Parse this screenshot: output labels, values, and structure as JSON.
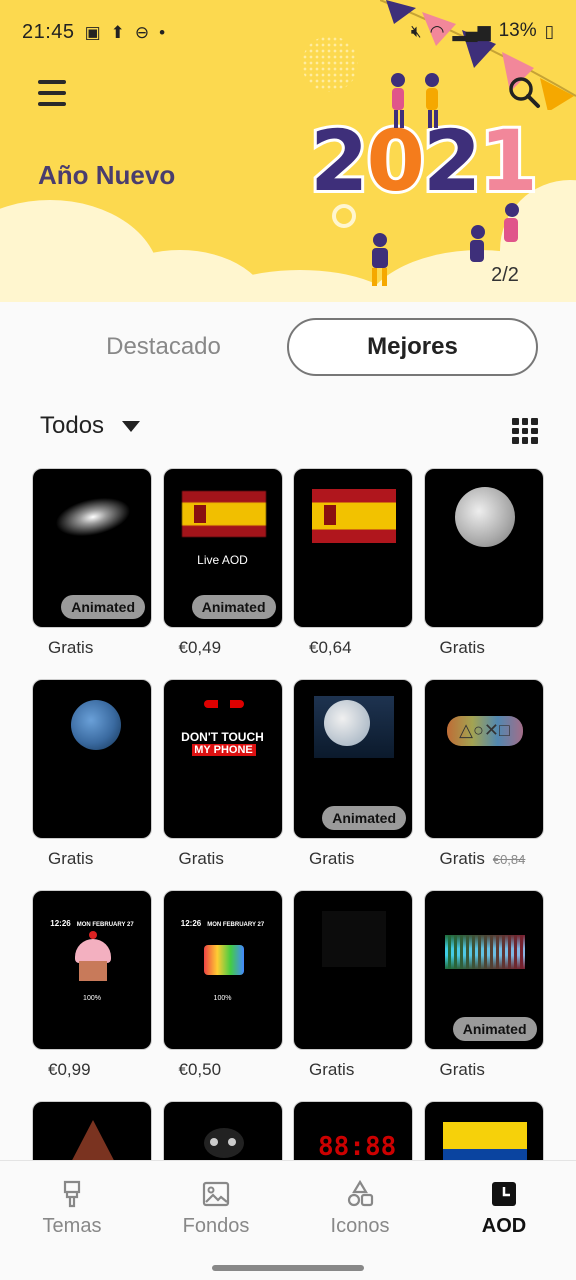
{
  "status_bar": {
    "time": "21:45",
    "battery": "13%"
  },
  "banner": {
    "title": "Año Nuevo",
    "year": "2021",
    "pager": "2/2"
  },
  "tabs": {
    "featured": "Destacado",
    "top": "Mejores"
  },
  "filter": {
    "label": "Todos"
  },
  "cards": [
    {
      "price": "Gratis",
      "badge": "Animated",
      "art": "galaxy"
    },
    {
      "price": "€0,49",
      "badge": "Animated",
      "art": "spain-flag-live",
      "caption": "Live AOD"
    },
    {
      "price": "€0,64",
      "art": "spain-flag"
    },
    {
      "price": "Gratis",
      "art": "moon"
    },
    {
      "price": "Gratis",
      "art": "earth"
    },
    {
      "price": "Gratis",
      "art": "dont-touch",
      "caption_top": "DON'T TOUCH",
      "caption_bottom": "MY PHONE"
    },
    {
      "price": "Gratis",
      "badge": "Animated",
      "art": "moon-landscape"
    },
    {
      "price": "Gratis",
      "old_price": "€0,84",
      "art": "playstation"
    },
    {
      "price": "€0,99",
      "art": "cupcake",
      "clock": "12:26",
      "date": "MON FEBRUARY 27",
      "level": "100%"
    },
    {
      "price": "€0,50",
      "art": "birthday",
      "clock": "12:26",
      "date": "MON FEBRUARY 27",
      "level": "100%"
    },
    {
      "price": "Gratis",
      "art": "dark-shapes"
    },
    {
      "price": "Gratis",
      "badge": "Animated",
      "art": "equalizer"
    },
    {
      "price": "",
      "art": "tree"
    },
    {
      "price": "",
      "art": "cat"
    },
    {
      "price": "",
      "art": "digital-clock"
    },
    {
      "price": "",
      "art": "ecuador-flag"
    }
  ],
  "nav": {
    "items": [
      {
        "label": "Temas",
        "icon": "brush-icon"
      },
      {
        "label": "Fondos",
        "icon": "image-icon"
      },
      {
        "label": "Iconos",
        "icon": "shapes-icon"
      },
      {
        "label": "AOD",
        "icon": "clock-icon",
        "active": true
      }
    ]
  },
  "colors": {
    "banner_bg": "#fcd94f",
    "year_purple": "#3e2f7a",
    "year_orange": "#f47c1c",
    "year_pink": "#f2879a"
  }
}
